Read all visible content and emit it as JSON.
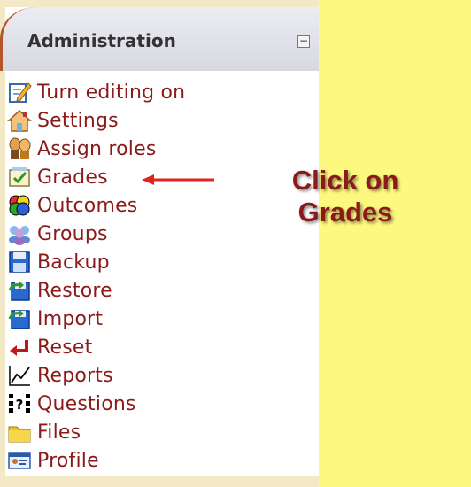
{
  "block": {
    "title": "Administration",
    "collapse_symbol": "−",
    "items": [
      {
        "label": "Turn editing on",
        "icon": "edit-icon"
      },
      {
        "label": "Settings",
        "icon": "settings-icon"
      },
      {
        "label": "Assign roles",
        "icon": "roles-icon"
      },
      {
        "label": "Grades",
        "icon": "grades-icon"
      },
      {
        "label": "Outcomes",
        "icon": "outcomes-icon"
      },
      {
        "label": "Groups",
        "icon": "groups-icon"
      },
      {
        "label": "Backup",
        "icon": "backup-icon"
      },
      {
        "label": "Restore",
        "icon": "restore-icon"
      },
      {
        "label": "Import",
        "icon": "import-icon"
      },
      {
        "label": "Reset",
        "icon": "reset-icon"
      },
      {
        "label": "Reports",
        "icon": "reports-icon"
      },
      {
        "label": "Questions",
        "icon": "questions-icon"
      },
      {
        "label": "Files",
        "icon": "files-icon"
      },
      {
        "label": "Profile",
        "icon": "profile-icon"
      }
    ]
  },
  "callout": {
    "line1": "Click on",
    "line2": "Grades"
  },
  "colors": {
    "link": "#8b1a1a",
    "note_bg": "#fdf97f",
    "arrow": "#e0241c"
  }
}
